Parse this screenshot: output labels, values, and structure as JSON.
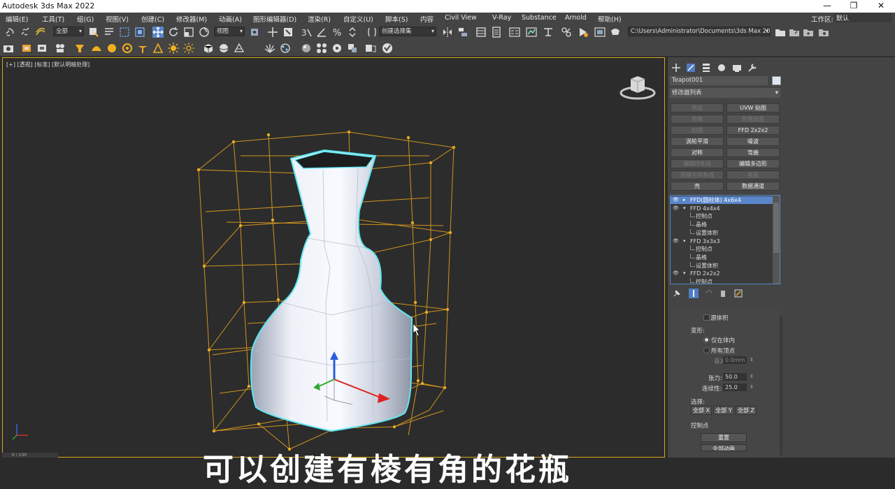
{
  "window": {
    "title": "Autodesk 3ds Max 2022",
    "min": "—",
    "restore": "❐",
    "close": "✕"
  },
  "menu": [
    "编辑(E)",
    "工具(T)",
    "组(G)",
    "视图(V)",
    "创建(C)",
    "修改器(M)",
    "动画(A)",
    "图形编辑器(D)",
    "渲染(R)",
    "自定义(U)",
    "脚本(S)",
    "内容",
    "Civil View",
    "V-Ray",
    "Substance",
    "Arnold",
    "帮助(H)"
  ],
  "workspace": {
    "label": "工作区:",
    "value": "默认"
  },
  "toolbar": {
    "selection_filter": "全部",
    "ref_coord": "视图",
    "named_selection": "创建选择集",
    "project_path": "C:\\Users\\Administrator\\Documents\\3ds Max 2022"
  },
  "viewport": {
    "label": "[+] [透视] [标准] [默认明暗处理]"
  },
  "subtitle": "可以创建有棱有角的花瓶",
  "command_panel": {
    "object_name": "Teapot001",
    "object_color": "#e0e6f0",
    "modifier_list": "修改器列表",
    "modifier_buttons": [
      {
        "label": "挤出",
        "dim": true
      },
      {
        "label": "UVW 贴图",
        "dim": false
      },
      {
        "label": "倒角",
        "dim": true
      },
      {
        "label": "倒角剖面",
        "dim": true
      },
      {
        "label": "扫描",
        "dim": true
      },
      {
        "label": "FFD 2x2x2",
        "dim": false
      },
      {
        "label": "涡轮平滑",
        "dim": false
      },
      {
        "label": "噪波",
        "dim": false
      },
      {
        "label": "对称",
        "dim": false
      },
      {
        "label": "弯曲",
        "dim": false
      },
      {
        "label": "编辑样条线",
        "dim": true
      },
      {
        "label": "编辑多边形",
        "dim": false
      },
      {
        "label": "规格化样条线",
        "dim": true
      },
      {
        "label": "曲面",
        "dim": true
      },
      {
        "label": "壳",
        "dim": false
      },
      {
        "label": "数据通道",
        "dim": false
      }
    ],
    "stack": [
      {
        "text": "FFD(圆柱体) 4x6x4",
        "level": 0,
        "eye": true,
        "selected": true
      },
      {
        "text": "FFD 4x4x4",
        "level": 0,
        "eye": true,
        "selected": false
      },
      {
        "text": "控制点",
        "level": 1,
        "eye": false,
        "selected": false
      },
      {
        "text": "晶格",
        "level": 1,
        "eye": false,
        "selected": false
      },
      {
        "text": "设置体积",
        "level": 1,
        "eye": false,
        "selected": false
      },
      {
        "text": "FFD 3x3x3",
        "level": 0,
        "eye": true,
        "selected": false
      },
      {
        "text": "控制点",
        "level": 1,
        "eye": false,
        "selected": false
      },
      {
        "text": "晶格",
        "level": 1,
        "eye": false,
        "selected": false
      },
      {
        "text": "设置体积",
        "level": 1,
        "eye": false,
        "selected": false
      },
      {
        "text": "FFD 2x2x2",
        "level": 0,
        "eye": true,
        "selected": false
      },
      {
        "text": "控制点",
        "level": 1,
        "eye": false,
        "selected": false
      }
    ],
    "rollout": {
      "source_volume": "源体积",
      "deform_label": "变形:",
      "only_in_volume": "仅在体内",
      "all_vertices": "所有顶点",
      "falloff_label": "衰减:",
      "falloff_value": "0.0mm",
      "tension_label": "张力:",
      "tension_value": "50.0",
      "continuity_label": "连续性:",
      "continuity_value": "25.0",
      "selection_label": "选择:",
      "all_x": "全部 X",
      "all_y": "全部 Y",
      "all_z": "全部 Z",
      "control_points_label": "控制点",
      "reset": "重置",
      "animate_all": "全部动画"
    }
  },
  "timeline": {
    "frame": "0 / 100"
  }
}
